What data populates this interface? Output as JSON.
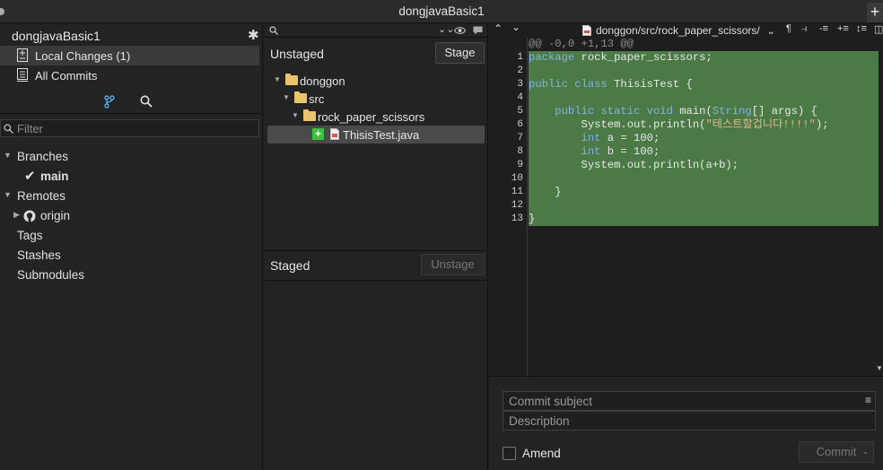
{
  "window": {
    "title": "dongjavaBasic1"
  },
  "sidebar": {
    "repo_name": "dongjavaBasic1",
    "nav": [
      {
        "label": "Local Changes (1)",
        "icon": "local-changes-icon"
      },
      {
        "label": "All Commits",
        "icon": "commits-icon"
      }
    ],
    "filter_placeholder": "Filter",
    "tree": {
      "branches_label": "Branches",
      "current_branch": "main",
      "remotes_label": "Remotes",
      "remote_origin": "origin",
      "tags_label": "Tags",
      "stashes_label": "Stashes",
      "submodules_label": "Submodules"
    }
  },
  "unstaged": {
    "title": "Unstaged",
    "stage_button": "Stage",
    "tree": [
      "donggon",
      "src",
      "rock_paper_scissors",
      "ThisisTest.java"
    ]
  },
  "staged": {
    "title": "Staged",
    "unstage_button": "Unstage"
  },
  "diff": {
    "file_path": "donggon/src/rock_paper_scissors/",
    "hunk_header": "@@ -0,0 +1,13 @@",
    "lines": [
      {
        "n": "1",
        "parts": [
          [
            "kw",
            "package"
          ],
          [
            "plain",
            " rock_paper_scissors;"
          ]
        ]
      },
      {
        "n": "2",
        "parts": []
      },
      {
        "n": "3",
        "parts": [
          [
            "kw",
            "public"
          ],
          [
            "plain",
            " "
          ],
          [
            "kw",
            "class"
          ],
          [
            "plain",
            " ThisisTest {"
          ]
        ]
      },
      {
        "n": "4",
        "parts": []
      },
      {
        "n": "5",
        "parts": [
          [
            "plain",
            "    "
          ],
          [
            "kw",
            "public static void"
          ],
          [
            "plain",
            " main("
          ],
          [
            "cls",
            "String"
          ],
          [
            "plain",
            "[] args) {"
          ]
        ]
      },
      {
        "n": "6",
        "parts": [
          [
            "plain",
            "        System.out.println("
          ],
          [
            "str",
            "\"테스트할겁니다!!!!\""
          ],
          [
            "plain",
            ");"
          ]
        ]
      },
      {
        "n": "7",
        "parts": [
          [
            "plain",
            "        "
          ],
          [
            "kw",
            "int"
          ],
          [
            "plain",
            " a = 100;"
          ]
        ]
      },
      {
        "n": "8",
        "parts": [
          [
            "plain",
            "        "
          ],
          [
            "kw",
            "int"
          ],
          [
            "plain",
            " b = 100;"
          ]
        ]
      },
      {
        "n": "9",
        "parts": [
          [
            "plain",
            "        System.out.println(a+b);"
          ]
        ]
      },
      {
        "n": "10",
        "parts": []
      },
      {
        "n": "11",
        "parts": [
          [
            "plain",
            "    }"
          ]
        ]
      },
      {
        "n": "12",
        "parts": []
      },
      {
        "n": "13",
        "parts": [
          [
            "plain",
            "}"
          ]
        ]
      }
    ]
  },
  "commit": {
    "subject_placeholder": "Commit subject",
    "description_placeholder": "Description",
    "amend_label": "Amend",
    "commit_button": "Commit"
  }
}
